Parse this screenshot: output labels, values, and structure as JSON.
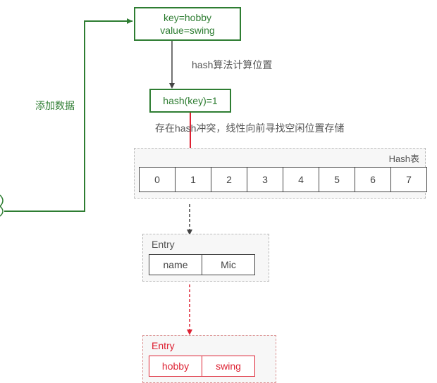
{
  "input_box": {
    "line1": "key=hobby",
    "line2": "value=swing"
  },
  "add_label": "添加数据",
  "hash_step_label": "hash算法计算位置",
  "hash_result_box": "hash(key)=1",
  "collision_label": "存在hash冲突，线性向前寻找空闲位置存储",
  "hash_table": {
    "title": "Hash表",
    "slots": [
      "0",
      "1",
      "2",
      "3",
      "4",
      "5",
      "6",
      "7"
    ]
  },
  "entry1": {
    "title": "Entry",
    "k": "name",
    "v": "Mic"
  },
  "entry2": {
    "title": "Entry",
    "k": "hobby",
    "v": "swing"
  },
  "chart_data": {
    "type": "table",
    "title": "Hash table open addressing (linear probing) insertion",
    "operation": "insert",
    "insert_key": "hobby",
    "insert_value": "swing",
    "hash_index": 1,
    "collision": true,
    "probing": "linear",
    "table_size": 8,
    "slots_before": [
      null,
      {
        "key": "name",
        "value": "Mic"
      },
      null,
      null,
      null,
      null,
      null,
      null
    ],
    "probe_sequence": [
      1,
      2
    ],
    "new_entry_slot": 2,
    "new_entry": {
      "key": "hobby",
      "value": "swing"
    }
  }
}
